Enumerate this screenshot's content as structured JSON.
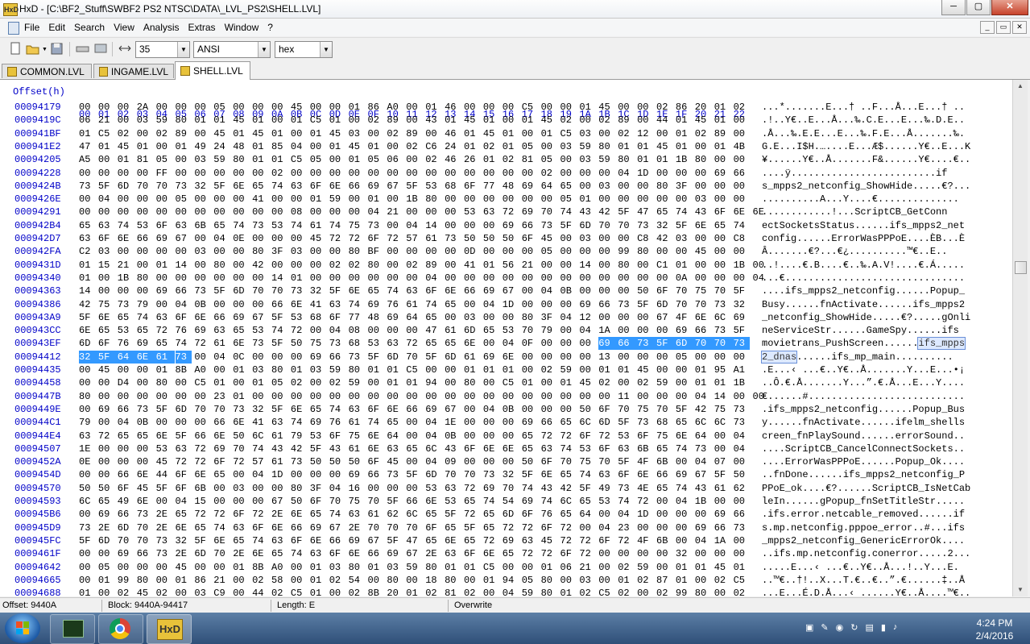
{
  "window": {
    "title": "HxD - [C:\\BF2_Stuff\\SWBF2 PS2 NTSC\\DATA\\_LVL_PS2\\SHELL.LVL]",
    "app_icon_text": "HxD",
    "minimize": "─",
    "maximize": "▢",
    "close": "✕"
  },
  "menu": {
    "items": [
      "File",
      "Edit",
      "Search",
      "View",
      "Analysis",
      "Extras",
      "Window",
      "?"
    ],
    "mdi_buttons": [
      "_",
      "▭",
      "✕"
    ]
  },
  "toolbar": {
    "bytes_per_row": "35",
    "charset": "ANSI",
    "display_mode": "hex",
    "icons": [
      "new-file-icon",
      "open-file-icon",
      "save-icon",
      "disk-icon",
      "ram-icon",
      "columns-icon"
    ]
  },
  "tabs": [
    {
      "label": "COMMON.LVL",
      "active": false
    },
    {
      "label": "INGAME.LVL",
      "active": false
    },
    {
      "label": "SHELL.LVL",
      "active": true
    }
  ],
  "hex": {
    "offset_header": "Offset(h)",
    "columns": [
      "00",
      "01",
      "02",
      "03",
      "04",
      "05",
      "06",
      "07",
      "08",
      "09",
      "0A",
      "0B",
      "0C",
      "0D",
      "0E",
      "0F",
      "10",
      "11",
      "12",
      "13",
      "14",
      "15",
      "16",
      "17",
      "18",
      "19",
      "1A",
      "1B",
      "1C",
      "1D",
      "1E",
      "1F",
      "20",
      "21",
      "22"
    ],
    "rows": [
      {
        "offset": "00094179",
        "bytes": "00 00 00 2A 00 00 00 05 00 00 00 45 00 00 01 86 A0 00 01 46 00 00 00 C5 00 00 01 45 00 00 02 86 20 01 02",
        "text": "...*.......E...† ..F...Å...E...† .."
      },
      {
        "offset": "0009419C",
        "bytes": "06 21 00 03 59 80 01 01 45 01 00 01 C5 01 00 02 89 00 43 01 45 01 00 01 45 02 00 02 89 00 44 01 45 01 00",
        "text": ".!..Y€..E...Å...‰.C.E...E...‰.D.E.."
      },
      {
        "offset": "000941BF",
        "bytes": "01 C5 02 00 02 89 00 45 01 45 01 00 01 45 03 00 02 89 00 46 01 45 01 00 01 C5 03 00 02 12 00 01 02 89 00",
        "text": ".Å...‰.E.E...E...‰.F.E...Å.......‰."
      },
      {
        "offset": "000941E2",
        "bytes": "47 01 45 01 00 01 49 24 48 01 85 04 00 01 45 01 00 02 C6 24 01 02 01 05 00 03 59 80 01 01 45 01 00 01 4B",
        "text": "G.E...I$H.…....E...Æ$......Y€..E...K"
      },
      {
        "offset": "00094205",
        "bytes": "A5 00 01 81 05 00 03 59 80 01 01 C5 05 00 01 05 06 00 02 46 26 01 02 81 05 00 03 59 80 01 01 1B 80 00 00",
        "text": "¥......Y€..Å.......F&......Y€....€.."
      },
      {
        "offset": "00094228",
        "bytes": "00 00 00 00 FF 00 00 00 00 00 02 00 00 00 00 00 00 00 00 00 00 00 00 00 02 00 00 00 04 1D 00 00 00 69 66",
        "text": "....ÿ.........................if"
      },
      {
        "offset": "0009424B",
        "bytes": "73 5F 6D 70 70 73 32 5F 6E 65 74 63 6F 6E 66 69 67 5F 53 68 6F 77 48 69 64 65 00 03 00 00 80 3F 00 00 00",
        "text": "s_mpps2_netconfig_ShowHide.....€?..."
      },
      {
        "offset": "0009426E",
        "bytes": "00 04 00 00 00 05 00 00 00 41 00 00 01 59 00 01 00 1B 80 00 00 00 00 00 00 05 01 00 00 00 00 00 03 00 00",
        "text": "..........A...Y....€.............."
      },
      {
        "offset": "00094291",
        "bytes": "00 00 00 00 00 00 00 00 00 00 00 08 00 00 00 04 21 00 00 00 53 63 72 69 70 74 43 42 5F 47 65 74 43 6F 6E 6E",
        "text": "............!...ScriptCB_GetConn"
      },
      {
        "offset": "000942B4",
        "bytes": "65 63 74 53 6F 63 6B 65 74 73 53 74 61 74 75 73 00 04 14 00 00 00 69 66 73 5F 6D 70 70 73 32 5F 6E 65 74",
        "text": "ectSocketsStatus......ifs_mpps2_net"
      },
      {
        "offset": "000942D7",
        "bytes": "63 6F 6E 66 69 67 00 04 0E 00 00 00 45 72 72 6F 72 57 61 73 50 50 50 6F 45 00 03 00 00 C8 42 03 00 00 C8",
        "text": "config......ErrorWasPPPoE....ÈB...È"
      },
      {
        "offset": "000942FA",
        "bytes": "C2 03 00 00 00 00 03 00 00 80 3F 03 00 00 80 BF 00 00 00 00 0D 00 00 00 05 00 00 00 99 80 00 00 45 00 00",
        "text": "Â.......€?...€¿..........™€..E.."
      },
      {
        "offset": "0009431D",
        "bytes": "01 15 21 00 01 14 00 80 00 42 00 00 00 02 02 80 00 02 89 00 41 01 56 21 00 00 14 00 80 00 C1 01 00 00 1B 00",
        "text": "..!....€.B....€..‰.A.V!....€.Á....."
      },
      {
        "offset": "00094340",
        "bytes": "01 00 1B 80 00 00 00 00 00 00 14 01 00 00 00 00 00 00 04 00 00 00 00 00 00 00 00 00 00 00 00 0A 00 00 00 04",
        "text": "...€..............................."
      },
      {
        "offset": "00094363",
        "bytes": "14 00 00 00 69 66 73 5F 6D 70 70 73 32 5F 6E 65 74 63 6F 6E 66 69 67 00 04 0B 00 00 00 50 6F 70 75 70 5F",
        "text": "....ifs_mpps2_netconfig......Popup_"
      },
      {
        "offset": "00094386",
        "bytes": "42 75 73 79 00 04 0B 00 00 00 66 6E 41 63 74 69 76 61 74 65 00 04 1D 00 00 00 69 66 73 5F 6D 70 70 73 32",
        "text": "Busy......fnActivate......ifs_mpps2"
      },
      {
        "offset": "000943A9",
        "bytes": "5F 6E 65 74 63 6F 6E 66 69 67 5F 53 68 6F 77 48 69 64 65 00 03 00 00 80 3F 04 12 00 00 00 67 4F 6E 6C 69",
        "text": "_netconfig_ShowHide.....€?.....gOnli"
      },
      {
        "offset": "000943CC",
        "bytes": "6E 65 53 65 72 76 69 63 65 53 74 72 00 04 08 00 00 00 47 61 6D 65 53 70 79 00 04 1A 00 00 00 69 66 73 5F",
        "text": "neServiceStr......GameSpy......ifs"
      },
      {
        "offset": "000943EF",
        "bytes": "6D 6F 76 69 65 74 72 61 6E 73 5F 50 75 73 68 53 63 72 65 65 6E 00 04 0F 00 00 00 69 66 73 5F 6D 70 70 73",
        "text": "movietrans_PushScreen......ifs_mpps",
        "text_sel_start": 27,
        "sel_from": 27
      },
      {
        "offset": "00094412",
        "bytes": "32 5F 64 6E 61 73 00 04 0C 00 00 00 69 66 73 5F 6D 70 5F 6D 61 69 6E 00 00 00 00 13 00 00 00 05 00 00 00",
        "text": "2_dnas......ifs_mp_main..........",
        "sel_to": 5
      },
      {
        "offset": "00094435",
        "bytes": "00 45 00 00 01 8B A0 00 01 03 80 01 03 59 80 01 01 C5 00 00 01 01 01 00 02 59 00 01 01 45 00 00 01 95 A1",
        "text": ".E...‹ ...€..Y€..Å.......Y...E...•¡"
      },
      {
        "offset": "00094458",
        "bytes": "00 00 D4 00 80 00 C5 01 00 01 05 02 00 02 59 00 01 01 94 00 80 00 C5 01 00 01 45 02 00 02 59 00 01 01 1B",
        "text": "..Ô.€.Å.......Y...”.€.Å...E...Y...."
      },
      {
        "offset": "0009447B",
        "bytes": "80 00 00 00 00 00 00 23 01 00 00 00 00 00 00 00 00 00 00 00 00 00 00 00 00 00 00 00 11 00 00 00 04 14 00 00",
        "text": "€......#..........................."
      },
      {
        "offset": "0009449E",
        "bytes": "00 69 66 73 5F 6D 70 70 73 32 5F 6E 65 74 63 6F 6E 66 69 67 00 04 0B 00 00 00 50 6F 70 75 70 5F 42 75 73",
        "text": ".ifs_mpps2_netconfig......Popup_Bus"
      },
      {
        "offset": "000944C1",
        "bytes": "79 00 04 0B 00 00 00 66 6E 41 63 74 69 76 61 74 65 00 04 1E 00 00 00 69 66 65 6C 6D 5F 73 68 65 6C 6C 73",
        "text": "y......fnActivate......ifelm_shells"
      },
      {
        "offset": "000944E4",
        "bytes": "63 72 65 65 6E 5F 66 6E 50 6C 61 79 53 6F 75 6E 64 00 04 0B 00 00 00 65 72 72 6F 72 53 6F 75 6E 64 00 04",
        "text": "creen_fnPlaySound......errorSound.."
      },
      {
        "offset": "00094507",
        "bytes": "1E 00 00 00 53 63 72 69 70 74 43 42 5F 43 61 6E 63 65 6C 43 6F 6E 6E 65 63 74 53 6F 63 6B 65 74 73 00 04",
        "text": "....ScriptCB_CancelConnectSockets.."
      },
      {
        "offset": "0009452A",
        "bytes": "0E 00 00 00 45 72 72 6F 72 57 61 73 50 50 50 6F 45 00 04 09 00 00 00 50 6F 70 75 70 5F 4F 6B 00 04 07 00",
        "text": "....ErrorWasPPPoE......Popup_Ok...."
      },
      {
        "offset": "0009454D",
        "bytes": "00 00 66 6E 44 6F 6E 65 00 04 1D 00 00 00 69 66 73 5F 6D 70 70 73 32 5F 6E 65 74 63 6F 6E 66 69 67 5F 50",
        "text": "..fnDone......ifs_mpps2_netconfig_P"
      },
      {
        "offset": "00094570",
        "bytes": "50 50 6F 45 5F 6F 6B 00 03 00 00 80 3F 04 16 00 00 00 53 63 72 69 70 74 43 42 5F 49 73 4E 65 74 43 61 62",
        "text": "PPoE_ok....€?......ScriptCB_IsNetCab"
      },
      {
        "offset": "00094593",
        "bytes": "6C 65 49 6E 00 04 15 00 00 00 67 50 6F 70 75 70 5F 66 6E 53 65 74 54 69 74 6C 65 53 74 72 00 04 1B 00 00",
        "text": "leIn......gPopup_fnSetTitleStr....."
      },
      {
        "offset": "000945B6",
        "bytes": "00 69 66 73 2E 65 72 72 6F 72 2E 6E 65 74 63 61 62 6C 65 5F 72 65 6D 6F 76 65 64 00 04 1D 00 00 00 69 66",
        "text": ".ifs.error.netcable_removed......if"
      },
      {
        "offset": "000945D9",
        "bytes": "73 2E 6D 70 2E 6E 65 74 63 6F 6E 66 69 67 2E 70 70 70 6F 65 5F 65 72 72 6F 72 00 04 23 00 00 00 69 66 73",
        "text": "s.mp.netconfig.pppoe_error..#...ifs"
      },
      {
        "offset": "000945FC",
        "bytes": "5F 6D 70 70 73 32 5F 6E 65 74 63 6F 6E 66 69 67 5F 47 65 6E 65 72 69 63 45 72 72 6F 72 4F 6B 00 04 1A 00",
        "text": "_mpps2_netconfig_GenericErrorOk...."
      },
      {
        "offset": "0009461F",
        "bytes": "00 00 69 66 73 2E 6D 70 2E 6E 65 74 63 6F 6E 66 69 67 2E 63 6F 6E 65 72 72 6F 72 00 00 00 00 32 00 00 00",
        "text": "..ifs.mp.netconfig.conerror.....2..."
      },
      {
        "offset": "00094642",
        "bytes": "00 05 00 00 00 45 00 00 01 8B A0 00 01 03 80 01 03 59 80 01 01 C5 00 00 01 06 21 00 02 59 00 01 01 45 01",
        "text": ".....E...‹ ...€..Y€..Å...!..Y...E."
      },
      {
        "offset": "00094665",
        "bytes": "00 01 99 80 00 01 86 21 00 02 58 00 01 02 54 00 80 00 18 80 00 01 94 05 80 00 03 00 01 02 87 01 00 02 C5",
        "text": "..™€..†!..X...T.€..€..”.€......‡..Å"
      },
      {
        "offset": "00094688",
        "bytes": "01 00 02 45 02 00 03 C9 00 44 02 C5 01 00 02 8B 20 01 02 81 02 00 04 59 80 01 02 C5 02 00 02 99 80 00 02",
        "text": "...E...É.D.Å...‹ ......Y€..Å....™€.."
      }
    ]
  },
  "selection": {
    "text_first": "ifs_mpps",
    "text_second": "2_dnas"
  },
  "status": {
    "offset": "Offset: 9440A",
    "block": "Block: 9440A-94417",
    "length": "Length: E",
    "mode": "Overwrite"
  },
  "taskbar": {
    "apps": [
      "terminal-app",
      "chrome-app",
      "hxd-app"
    ],
    "hxd_label": "HxD",
    "time": "4:24 PM",
    "date": "2/4/2016"
  }
}
